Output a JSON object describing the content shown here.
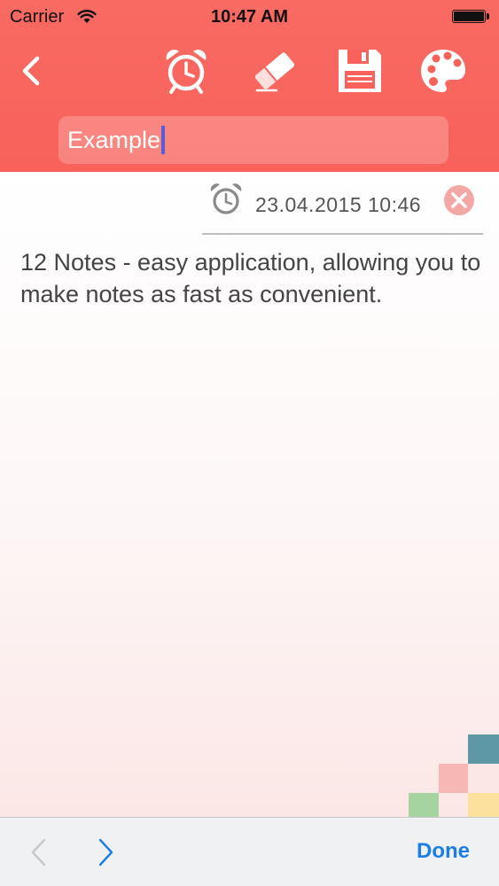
{
  "status_bar": {
    "carrier": "Carrier",
    "time": "10:47 AM"
  },
  "toolbar": {
    "icons": [
      "back-chevron-icon",
      "alarm-clock-icon",
      "eraser-icon",
      "floppy-disk-icon",
      "palette-icon"
    ]
  },
  "note": {
    "title": "Example",
    "alarm_datetime": "23.04.2015 10:46",
    "body": "12 Notes - easy application, allowing you to make notes as fast as convenient."
  },
  "keyboard_toolbar": {
    "done_label": "Done"
  },
  "colors": {
    "header": "#f8625b",
    "accent_blue": "#1a7ee6",
    "remove_circle": "#f4a8a6",
    "pixel_teal": "#5e97a6",
    "pixel_pink": "#f6b7b5",
    "pixel_green": "#a6d4a1",
    "pixel_yellow": "#fbe19d"
  }
}
